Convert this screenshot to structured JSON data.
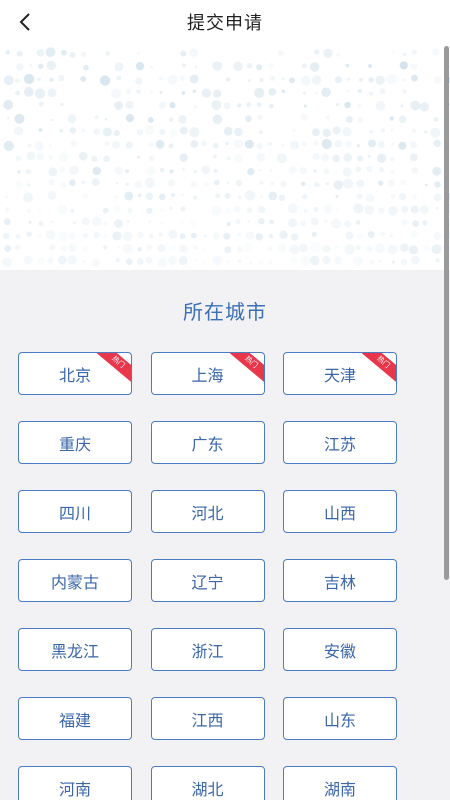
{
  "header": {
    "title": "提交申请",
    "back_icon": "chevron-left-icon"
  },
  "section": {
    "title": "所在城市"
  },
  "cities": [
    {
      "name": "北京",
      "hot": true
    },
    {
      "name": "上海",
      "hot": true
    },
    {
      "name": "天津",
      "hot": true
    },
    {
      "name": "重庆",
      "hot": false
    },
    {
      "name": "广东",
      "hot": false
    },
    {
      "name": "江苏",
      "hot": false
    },
    {
      "name": "四川",
      "hot": false
    },
    {
      "name": "河北",
      "hot": false
    },
    {
      "name": "山西",
      "hot": false
    },
    {
      "name": "内蒙古",
      "hot": false
    },
    {
      "name": "辽宁",
      "hot": false
    },
    {
      "name": "吉林",
      "hot": false
    },
    {
      "name": "黑龙江",
      "hot": false
    },
    {
      "name": "浙江",
      "hot": false
    },
    {
      "name": "安徽",
      "hot": false
    },
    {
      "name": "福建",
      "hot": false
    },
    {
      "name": "江西",
      "hot": false
    },
    {
      "name": "山东",
      "hot": false
    },
    {
      "name": "河南",
      "hot": false
    },
    {
      "name": "湖北",
      "hot": false
    },
    {
      "name": "湖南",
      "hot": false
    }
  ],
  "hot_badge": "热门",
  "colors": {
    "accent": "#3b6fb6",
    "button_border": "#4a7cc4",
    "hot_badge": "#e8364a",
    "background": "#f2f2f4"
  }
}
